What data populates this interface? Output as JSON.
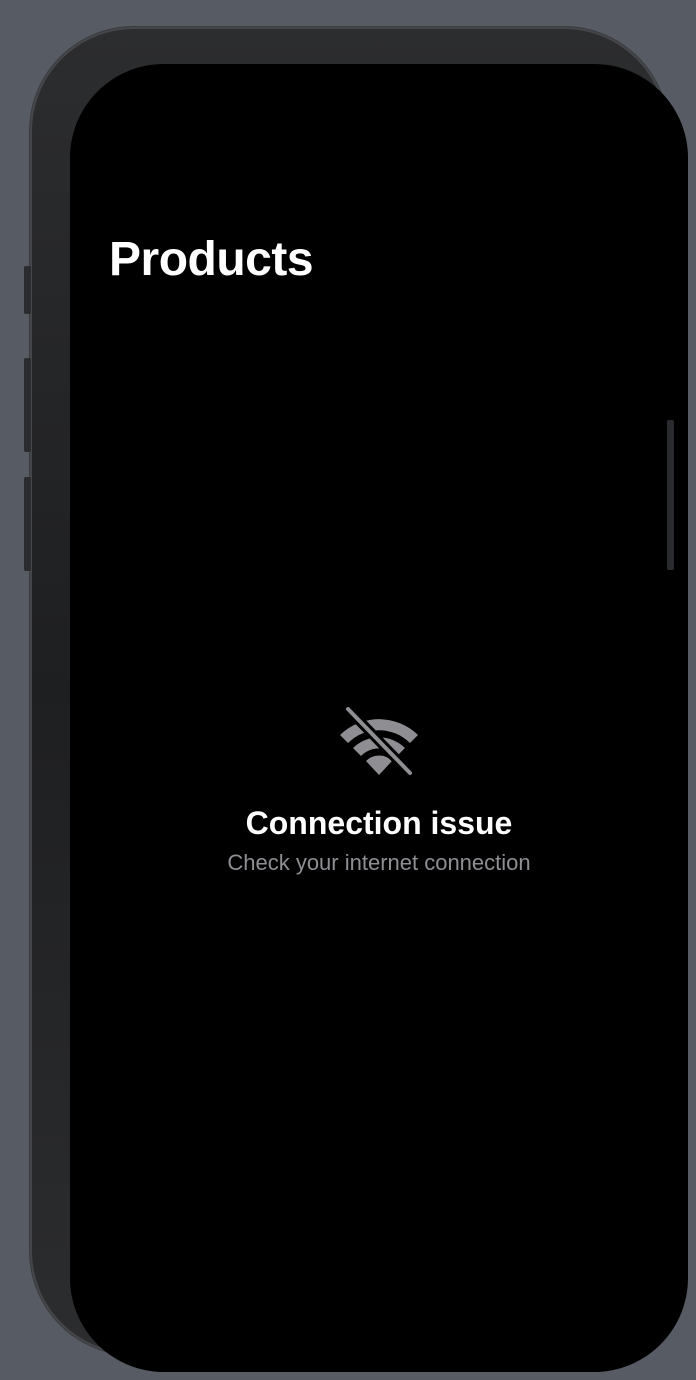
{
  "header": {
    "title": "Products"
  },
  "empty_state": {
    "icon": "wifi-slash-icon",
    "title": "Connection issue",
    "message": "Check your internet connection"
  },
  "colors": {
    "background": "#000000",
    "title_text": "#ffffff",
    "secondary_text": "#8e8e93",
    "icon": "#8e8e93"
  }
}
